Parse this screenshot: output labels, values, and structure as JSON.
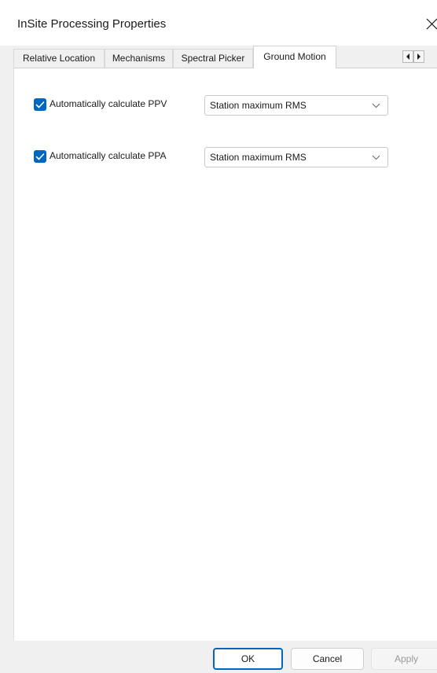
{
  "window": {
    "title": "InSite Processing Properties"
  },
  "tabs": [
    {
      "label": "Relative Location",
      "active": false
    },
    {
      "label": "Mechanisms",
      "active": false
    },
    {
      "label": "Spectral Picker",
      "active": false
    },
    {
      "label": "Ground Motion",
      "active": true
    }
  ],
  "tab_scroll": {
    "left_icon": "arrow-left-icon",
    "right_icon": "arrow-right-icon"
  },
  "ground_motion": {
    "ppv": {
      "checked": true,
      "label": "Automatically calculate PPV",
      "selected": "Station maximum RMS"
    },
    "ppa": {
      "checked": true,
      "label": "Automatically calculate PPA",
      "selected": "Station maximum RMS"
    }
  },
  "buttons": {
    "ok": "OK",
    "cancel": "Cancel",
    "apply": "Apply"
  },
  "colors": {
    "accent": "#0067c0",
    "window_bg": "#f0f0f0",
    "panel_bg": "#ffffff",
    "disabled_text": "#9a9a9a"
  }
}
